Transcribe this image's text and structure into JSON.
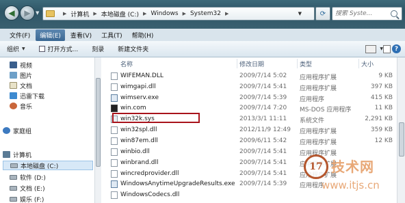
{
  "address_bar": {
    "breadcrumbs": [
      "计算机",
      "本地磁盘 (C:)",
      "Windows",
      "System32"
    ],
    "search_placeholder": "搜索 Syste..."
  },
  "menu": [
    "文件(F)",
    "编辑(E)",
    "查看(V)",
    "工具(T)",
    "帮助(H)"
  ],
  "menu_active_index": 1,
  "toolbar": {
    "organize": "组织",
    "open_with": "打开方式...",
    "burn": "刻录",
    "new_folder": "新建文件夹"
  },
  "nav_pane": [
    {
      "label": "视频",
      "icon": "video-icon"
    },
    {
      "label": "图片",
      "icon": "picture-icon"
    },
    {
      "label": "文档",
      "icon": "document-icon"
    },
    {
      "label": "迅雷下载",
      "icon": "download-icon"
    },
    {
      "label": "音乐",
      "icon": "music-icon"
    },
    {
      "label": "家庭组",
      "icon": "homegroup-icon"
    },
    {
      "label": "计算机",
      "icon": "computer-icon"
    },
    {
      "label": "本地磁盘 (C:)",
      "icon": "drive-icon",
      "selected": true
    },
    {
      "label": "软件 (D:)",
      "icon": "drive-icon"
    },
    {
      "label": "文档 (E:)",
      "icon": "drive-icon"
    },
    {
      "label": "娱乐 (F:)",
      "icon": "drive-icon"
    }
  ],
  "columns": {
    "name": "名称",
    "date": "修改日期",
    "type": "类型",
    "size": "大小"
  },
  "files": [
    {
      "name": "WIFEMAN.DLL",
      "date": "2009/7/14 5:02",
      "type": "应用程序扩展",
      "size": "9 KB",
      "icon": "dll"
    },
    {
      "name": "wimgapi.dll",
      "date": "2009/7/14 5:41",
      "type": "应用程序扩展",
      "size": "397 KB",
      "icon": "dll"
    },
    {
      "name": "wimserv.exe",
      "date": "2009/7/14 5:39",
      "type": "应用程序",
      "size": "415 KB",
      "icon": "exe"
    },
    {
      "name": "win.com",
      "date": "2009/7/14 7:20",
      "type": "MS-DOS 应用程序",
      "size": "11 KB",
      "icon": "com"
    },
    {
      "name": "win32k.sys",
      "date": "2013/3/1 11:11",
      "type": "系统文件",
      "size": "2,291 KB",
      "icon": "sys"
    },
    {
      "name": "win32spl.dll",
      "date": "2012/11/9 12:49",
      "type": "应用程序扩展",
      "size": "359 KB",
      "icon": "dll"
    },
    {
      "name": "win87em.dll",
      "date": "2009/6/11 5:42",
      "type": "应用程序扩展",
      "size": "12 KB",
      "icon": "dll"
    },
    {
      "name": "winbio.dll",
      "date": "2009/7/14 5:41",
      "type": "应用程序扩展",
      "size": "...",
      "icon": "dll"
    },
    {
      "name": "winbrand.dll",
      "date": "2009/7/14 5:41",
      "type": "应用程序扩展",
      "size": "",
      "icon": "dll"
    },
    {
      "name": "wincredprovider.dll",
      "date": "2009/7/14 5:41",
      "type": "应用程序扩展",
      "size": "",
      "icon": "dll"
    },
    {
      "name": "WindowsAnytimeUpgradeResults.exe",
      "date": "2009/7/14 5:39",
      "type": "应用程序",
      "size": "",
      "icon": "exe"
    },
    {
      "name": "WindowsCodecs.dll",
      "date": "",
      "type": "",
      "size": "",
      "icon": "dll"
    }
  ],
  "highlighted_file": "win32k.sys",
  "watermark": {
    "logo": "17",
    "text": "技术网",
    "url": "www.itjs.cn"
  }
}
